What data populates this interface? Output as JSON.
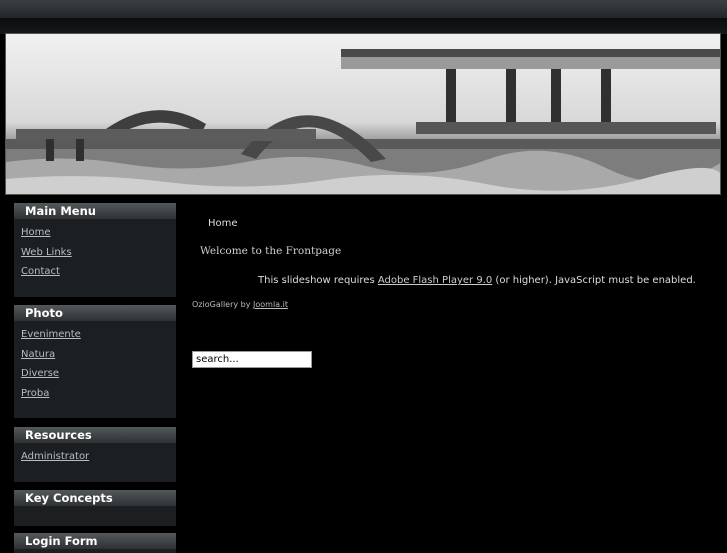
{
  "sidebar": {
    "main_menu": {
      "title": "Main Menu",
      "items": [
        "Home",
        "Web Links",
        "Contact"
      ]
    },
    "photo": {
      "title": "Photo",
      "items": [
        "Evenimente",
        "Natura",
        "Diverse",
        "Proba"
      ]
    },
    "resources": {
      "title": "Resources",
      "items": [
        "Administrator"
      ]
    },
    "key_concepts": {
      "title": "Key Concepts"
    },
    "login_form": {
      "title": "Login Form"
    }
  },
  "main": {
    "breadcrumb": "Home",
    "welcome": "Welcome to the Frontpage",
    "flash_prefix": "This slideshow requires ",
    "flash_link": "Adobe Flash Player 9.0",
    "flash_suffix": " (or higher). JavaScript must be enabled.",
    "ozio_prefix": "OzioGallery by ",
    "ozio_link": "Joomla.it",
    "search_value": "search..."
  }
}
